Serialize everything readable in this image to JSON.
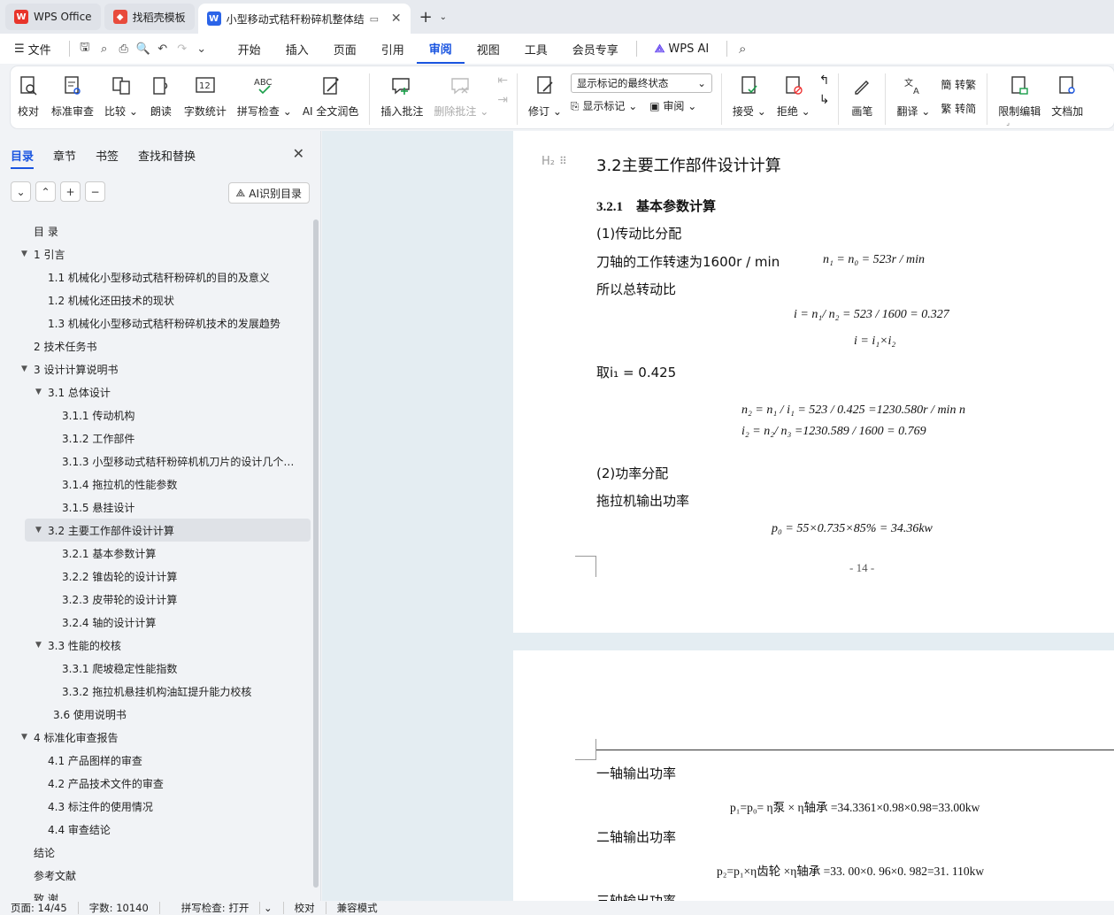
{
  "tabs": [
    {
      "label": "WPS Office",
      "color": "#e8352b"
    },
    {
      "label": "找稻壳模板",
      "color": "#e84b3c"
    },
    {
      "label": "小型移动式秸秆粉碎机整体结",
      "color": "#2b64e8"
    }
  ],
  "menu": {
    "file": "文件",
    "items": [
      "开始",
      "插入",
      "页面",
      "引用",
      "审阅",
      "视图",
      "工具",
      "会员专享"
    ],
    "active": "审阅",
    "ai": "WPS AI"
  },
  "ribbon": {
    "proofread": "校对",
    "standard_review": "标准审查",
    "compare": "比较",
    "read_aloud": "朗读",
    "word_count": "字数统计",
    "spell_check": "拼写检查",
    "ai_polish": "AI 全文润色",
    "insert_comment": "插入批注",
    "delete_comment": "删除批注",
    "revise": "修订",
    "markup_state": "显示标记的最终状态",
    "show_markup": "显示标记",
    "review": "审阅",
    "accept": "接受",
    "reject": "拒绝",
    "pen": "画笔",
    "translate": "翻译",
    "to_trad": "转繁",
    "to_simp": "转简",
    "restrict_edit": "限制编辑",
    "doc_protect": "文档加"
  },
  "sidebar": {
    "tabs": [
      "目录",
      "章节",
      "书签",
      "查找和替换"
    ],
    "ai_button": "AI识别目录",
    "toc": [
      {
        "label": "目  录",
        "level": 1,
        "arrow": false
      },
      {
        "label": "1  引言",
        "level": 1,
        "arrow": true
      },
      {
        "label": "1.1  机械化小型移动式秸秆粉碎机的目的及意义",
        "level": 2,
        "arrow": false
      },
      {
        "label": "1.2  机械化还田技术的现状",
        "level": 2,
        "arrow": false
      },
      {
        "label": "1.3  机械化小型移动式秸秆粉碎机技术的发展趋势",
        "level": 2,
        "arrow": false
      },
      {
        "label": "2  技术任务书",
        "level": 1,
        "arrow": false
      },
      {
        "label": "3  设计计算说明书",
        "level": 1,
        "arrow": true
      },
      {
        "label": "3.1  总体设计",
        "level": 2,
        "arrow": true
      },
      {
        "label": "3.1.1  传动机构",
        "level": 3,
        "arrow": false
      },
      {
        "label": "3.1.2  工作部件",
        "level": 3,
        "arrow": false
      },
      {
        "label": "3.1.3  小型移动式秸秆粉碎机机刀片的设计几个…",
        "level": 3,
        "arrow": false
      },
      {
        "label": "3.1.4  拖拉机的性能参数",
        "level": 3,
        "arrow": false
      },
      {
        "label": "3.1.5  悬挂设计",
        "level": 3,
        "arrow": false
      },
      {
        "label": "3.2  主要工作部件设计计算",
        "level": 2,
        "arrow": true,
        "selected": true
      },
      {
        "label": "3.2.1  基本参数计算",
        "level": 3,
        "arrow": false
      },
      {
        "label": "3.2.2  锥齿轮的设计计算",
        "level": 3,
        "arrow": false
      },
      {
        "label": "3.2.3  皮带轮的设计计算",
        "level": 3,
        "arrow": false
      },
      {
        "label": "3.2.4  轴的设计计算",
        "level": 3,
        "arrow": false
      },
      {
        "label": "3.3  性能的校核",
        "level": 2,
        "arrow": true
      },
      {
        "label": "3.3.1  爬坡稳定性能指数",
        "level": 3,
        "arrow": false
      },
      {
        "label": "3.3.2  拖拉机悬挂机构油缸提升能力校核",
        "level": 3,
        "arrow": false
      },
      {
        "label": "3.6 使用说明书",
        "level": 2.5,
        "arrow": false
      },
      {
        "label": "4  标准化审查报告",
        "level": 1,
        "arrow": true
      },
      {
        "label": "4.1  产品图样的审查",
        "level": 2,
        "arrow": false
      },
      {
        "label": "4.2  产品技术文件的审查",
        "level": 2,
        "arrow": false
      },
      {
        "label": "4.3  标注件的使用情况",
        "level": 2,
        "arrow": false
      },
      {
        "label": "4.4  审查结论",
        "level": 2,
        "arrow": false
      },
      {
        "label": "结论",
        "level": 1,
        "arrow": false
      },
      {
        "label": "参考文献",
        "level": 1,
        "arrow": false
      },
      {
        "label": "致  谢",
        "level": 1,
        "arrow": false
      }
    ]
  },
  "doc": {
    "heading_marker": "H₂",
    "h2": "3.2主要工作部件设计计算",
    "h3": "3.2.1    基本参数计算",
    "s1": "(1)传动比分配",
    "p1a": "刀轴的工作转速为1600r / min",
    "p1b": "n₁ = n₀ = 523r / min",
    "p2": "所以总转动比",
    "f1": "i = n₁/ n₂ = 523 / 1600 = 0.327",
    "f2": "i = i₁×i₂",
    "p3": "取i₁ = 0.425",
    "f3": "n₂ = n₁ / i₁ = 523 / 0.425 =1230.580r / min n",
    "f4": "i₂ = n₂/ n₃ =1230.589 / 1600 = 0.769",
    "s2": "(2)功率分配",
    "p4": "拖拉机输出功率",
    "f5": "p₀ = 55×0.735×85% = 34.36kw",
    "page_no": "- 14 -",
    "p5": "一轴输出功率",
    "f6": "p₁=p₀= η泵 × η轴承 =34.3361×0.98×0.98=33.00kw",
    "p6": "二轴输出功率",
    "f7": "p₂=p₁×η齿轮 ×η轴承 =33. 00×0. 96×0. 982=31. 110kw",
    "p7": "三轴输出功率"
  },
  "status": {
    "page": "页面: 14/45",
    "words": "字数: 10140",
    "spell": "拼写检查: 打开",
    "proof": "校对",
    "mode": "兼容模式"
  }
}
